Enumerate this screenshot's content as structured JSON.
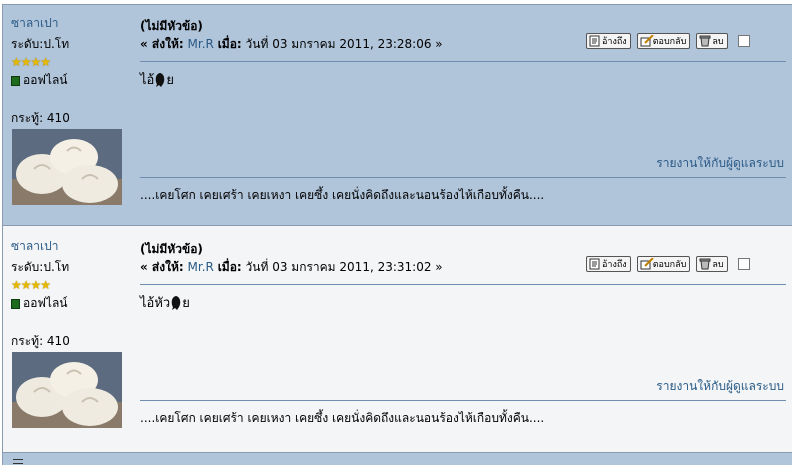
{
  "posts": [
    {
      "poster": {
        "name": "ซาลาเปา",
        "rank": "ระดับ:ป.โท",
        "stars": "★★★★",
        "status": "ออฟไลน์",
        "post_count": "กระทู้: 410"
      },
      "subject": "(ไม่มีหัวข้อ)",
      "meta": {
        "prefix": "« ส่งให้:",
        "recipient": "Mr.R",
        "when_label": "เมื่อ:",
        "timestamp": "วันที่ 03 มกราคม 2011, 23:28:06 »"
      },
      "buttons": {
        "quote": "อ้างถึง",
        "reply": "ตอบกลับ",
        "delete": "ลบ"
      },
      "body": "ไอ้",
      "body_suffix": "ย",
      "report": "รายงานให้กับผู้ดูแลระบบ",
      "signature": "....เคยโศก เคยเศร้า เคยเหงา เคยซึ้ง เคยนั่งคิดถึงและนอนร้องไห้เกือบทั้งคืน...."
    },
    {
      "poster": {
        "name": "ซาลาเปา",
        "rank": "ระดับ:ป.โท",
        "stars": "★★★★",
        "status": "ออฟไลน์",
        "post_count": "กระทู้: 410"
      },
      "subject": "(ไม่มีหัวข้อ)",
      "meta": {
        "prefix": "« ส่งให้:",
        "recipient": "Mr.R",
        "when_label": "เมื่อ:",
        "timestamp": "วันที่ 03 มกราคม 2011, 23:31:02 »"
      },
      "buttons": {
        "quote": "อ้างถึง",
        "reply": "ตอบกลับ",
        "delete": "ลบ"
      },
      "body": "ไอ้หัว",
      "body_suffix": "ย",
      "report": "รายงานให้กับผู้ดูแลระบบ",
      "signature": "....เคยโศก เคยเศร้า เคยเหงา เคยซึ้ง เคยนั่งคิดถึงและนอนร้องไห้เกือบทั้งคืน...."
    }
  ],
  "colors": {
    "dark_row": "#b0c4da",
    "light_row": "#f3f5f7",
    "link": "#2a5a86"
  }
}
